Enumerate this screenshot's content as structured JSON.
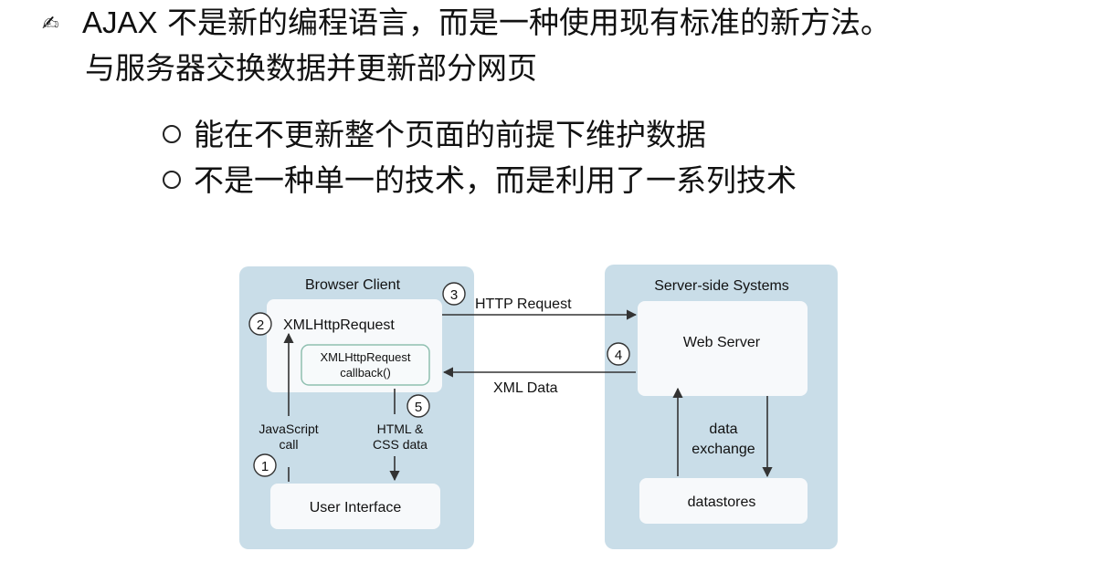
{
  "text": {
    "line1_icon": "writing-hand-icon",
    "line1_ajax": "AJAX",
    "line1_rest": " 不是新的编程语言，而是一种使用现有标准的新方法。",
    "line2": "与服务器交换数据并更新部分网页",
    "bullets": [
      "能在不更新整个页面的前提下维护数据",
      "不是一种单一的技术，而是利用了一系列技术"
    ]
  },
  "diagram": {
    "browser_title": "Browser Client",
    "server_title": "Server-side Systems",
    "xhr": "XMLHttpRequest",
    "callback_line1": "XMLHttpRequest",
    "callback_line2": "callback()",
    "user_interface": "User Interface",
    "web_server": "Web Server",
    "datastores": "datastores",
    "http_request": "HTTP Request",
    "xml_data": "XML Data",
    "js_call_line1": "JavaScript",
    "js_call_line2": "call",
    "html_css_line1": "HTML &",
    "html_css_line2": "CSS data",
    "data_exchange_line1": "data",
    "data_exchange_line2": "exchange",
    "step_numbers": [
      "1",
      "2",
      "3",
      "4",
      "5"
    ],
    "colors": {
      "panel": "#c9dde8",
      "box": "#f7f9fb",
      "text": "#111111"
    }
  }
}
